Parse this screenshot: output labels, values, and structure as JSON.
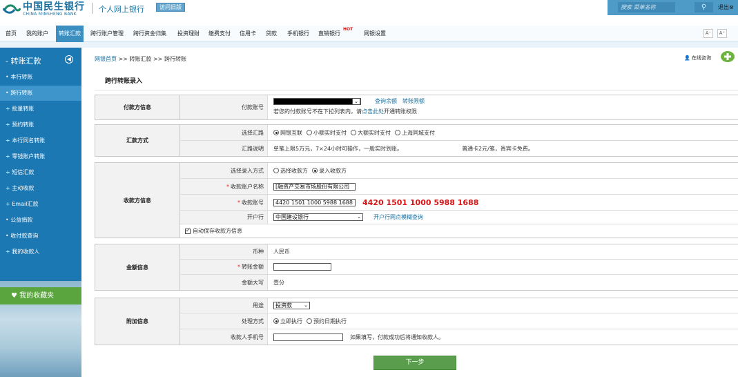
{
  "header": {
    "logo_cn": "中国民生银行",
    "logo_en": "CHINA MINSHENG BANK",
    "site_name": "个人网上银行",
    "old_version": "访问旧版",
    "search_placeholder": "搜索 菜单名称",
    "logout": "退出"
  },
  "nav": {
    "items": [
      "首页",
      "我的账户",
      "转账汇款",
      "跨行账户管理",
      "跨行资金归集",
      "投资理财",
      "缴费支付",
      "信用卡",
      "贷款",
      "手机银行",
      "直销银行",
      "网银设置"
    ],
    "hot": "HOT",
    "font_small": "A⁻",
    "font_large": "A⁺"
  },
  "sidebar": {
    "title": "转账汇款",
    "items": [
      "本行转账",
      "跨行转账",
      "批量转账",
      "预约转账",
      "本行同名转账",
      "零钱账户转账",
      "短信汇款",
      "主动收款",
      "Email汇款",
      "公益捐款",
      "收付款查询",
      "我的收款人"
    ],
    "favorites": "我的收藏夹"
  },
  "breadcrumb": {
    "home": "网银首页",
    "sep": " >> ",
    "level2": "转账汇款",
    "level3": "跨行转账"
  },
  "online_consult": "在线咨询",
  "page_title": "跨行转账录入",
  "payer": {
    "section": "付款方信息",
    "account_label": "付款账号",
    "query_balance": "查询余额",
    "transfer_limit": "转账限额",
    "note_prefix": "若您的付款账号不在下拉列表内，请",
    "note_link": "点击此处",
    "note_suffix": "开通转账权限"
  },
  "remit": {
    "section": "汇款方式",
    "route_label": "选择汇路",
    "routes": [
      "网银互联",
      "小额实时支付",
      "大额实时支付",
      "上海同城支付"
    ],
    "desc_label": "汇路说明",
    "desc": "单笔上限5万元，7×24小时可操作，一般实时到账。",
    "fee": "普通卡2元/笔，贵宾卡免费。"
  },
  "payee": {
    "section": "收款方信息",
    "mode_label": "选择录入方式",
    "modes": [
      "选择收款方",
      "录入收款方"
    ],
    "name_label": "收款账户名称",
    "name_value": "[融资产交易市场股份有限公司",
    "account_label": "收款账号",
    "account_value": "4420 1501 1000 5988 1688",
    "account_echo": "4420 1501 1000 5988 1688",
    "bank_label": "开户行",
    "bank_value": "中国建设银行",
    "bank_query": "开户行网点模糊查询",
    "autosave": "自动保存收款方信息"
  },
  "amount": {
    "section": "金额信息",
    "currency_label": "币种",
    "currency_value": "人民币",
    "amount_label": "转账金额",
    "upper_label": "金额大写",
    "upper_value": "壹分"
  },
  "extra": {
    "section": "附加信息",
    "purpose_label": "用途",
    "purpose_value": "投资款",
    "process_label": "处理方式",
    "process_options": [
      "立即执行",
      "预约日期执行"
    ],
    "phone_label": "收款人手机号",
    "phone_hint": "如果填写，付款成功后将通知收款人。"
  },
  "next_button": "下一步",
  "colors": {
    "brand_blue": "#1b78b3",
    "accent_green": "#5a9e4d",
    "alert_red": "#d91414"
  }
}
